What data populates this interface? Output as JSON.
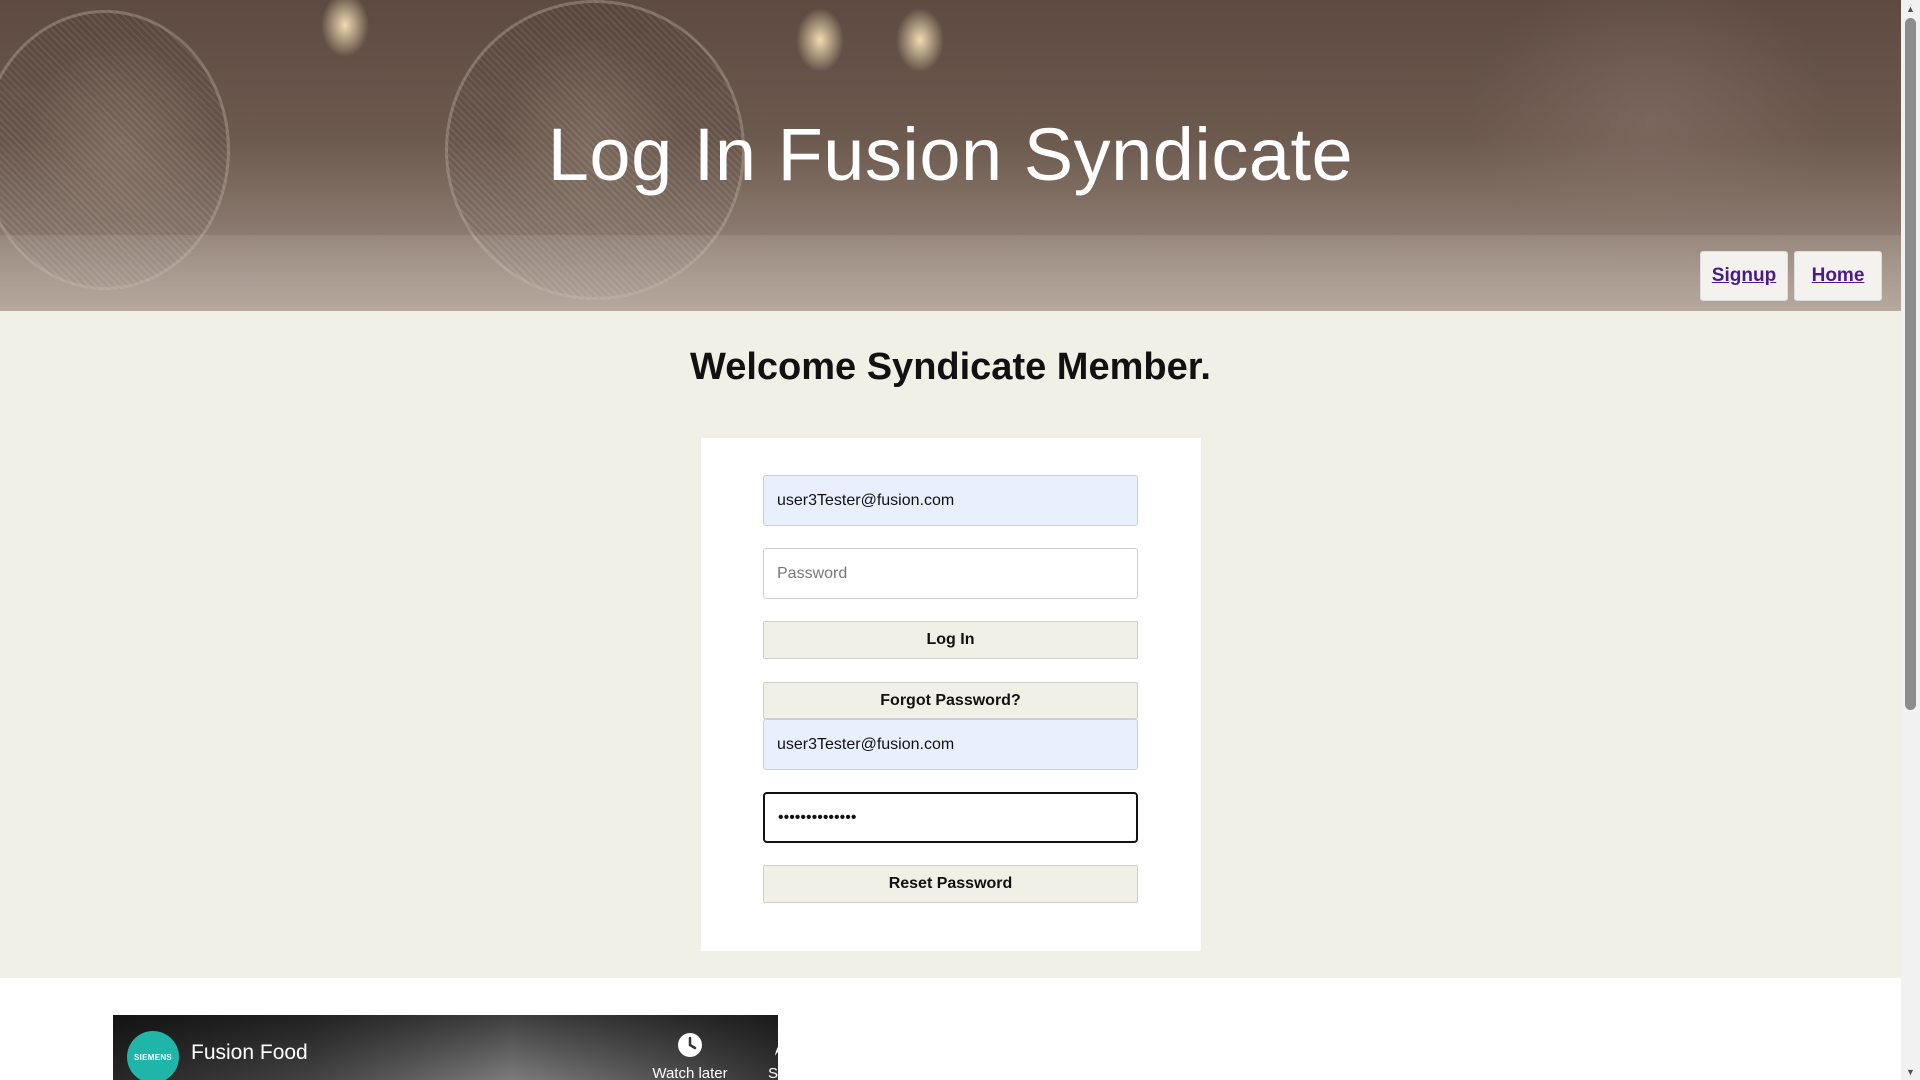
{
  "header": {
    "title": "Log In Fusion Syndicate",
    "nav": [
      {
        "label": "Signup"
      },
      {
        "label": "Home"
      }
    ]
  },
  "main": {
    "welcome": "Welcome Syndicate Member.",
    "login_form": {
      "email_value": "user3Tester@fusion.com",
      "password_placeholder": "Password",
      "login_button": "Log In",
      "forgot_button": "Forgot Password?"
    },
    "reset_form": {
      "email_value": "user3Tester@fusion.com",
      "password_masked": "••••••••••••••",
      "reset_button": "Reset Password"
    }
  },
  "video": {
    "channel": "SIEMENS",
    "title": "Fusion Food",
    "actions": [
      {
        "label": "Watch later",
        "icon": "clock-icon"
      },
      {
        "label": "Share",
        "icon": "share-icon"
      }
    ]
  },
  "colors": {
    "page_bg": "#f1f0e6",
    "nav_link": "#4a1a8a",
    "autofill_bg": "#e8f0fe",
    "channel_logo": "#1fb5a8"
  }
}
